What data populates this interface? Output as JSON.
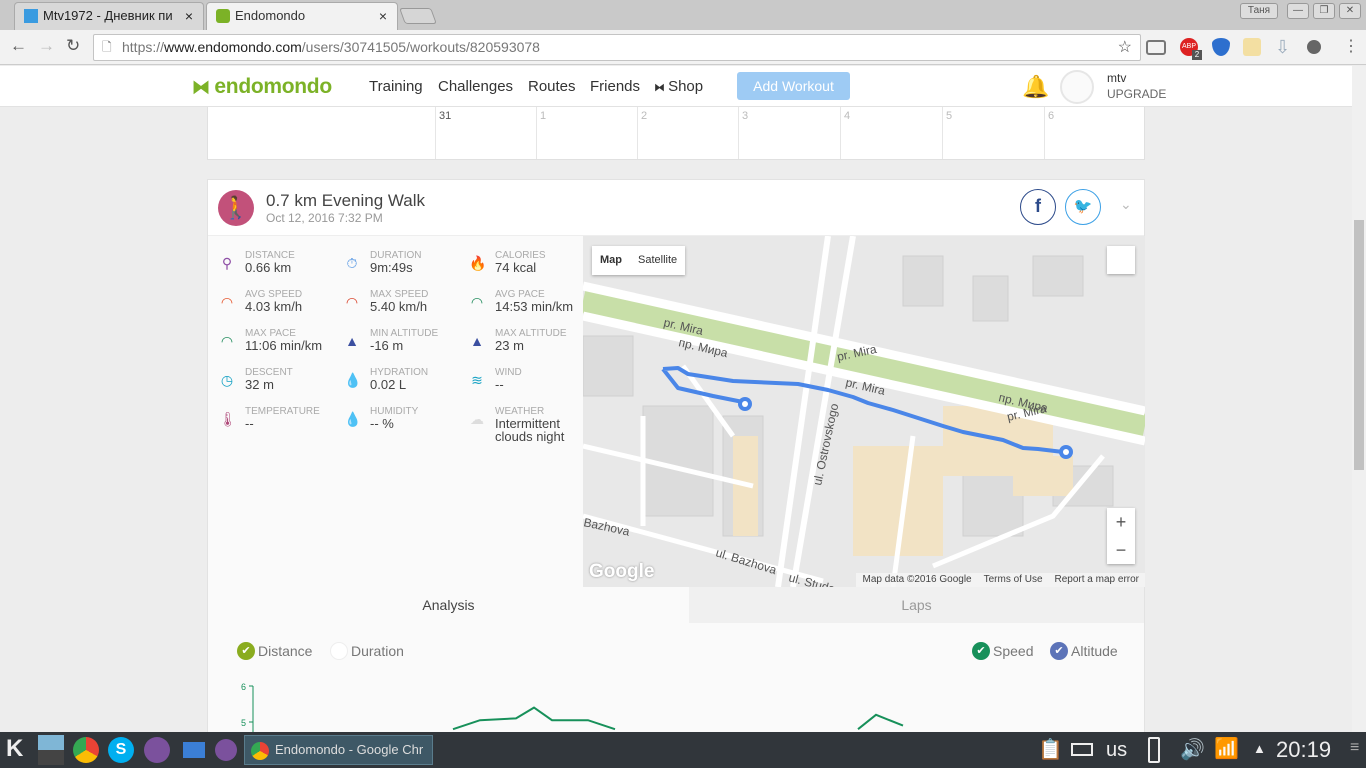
{
  "browser": {
    "tabs": [
      {
        "label": "Mtv1972 - Дневник пи",
        "active": false
      },
      {
        "label": "Endomondo",
        "active": true
      }
    ],
    "close_glyph": "×",
    "profile": "Таня",
    "url": {
      "scheme": "https://",
      "host": "www.endomondo.com",
      "path": "/users/30741505/workouts/820593078"
    },
    "extensions": [
      {
        "icon": "cast-icon"
      },
      {
        "icon": "adblock-icon",
        "badge": "2"
      },
      {
        "icon": "download-helper-icon"
      },
      {
        "icon": "extension-icon"
      },
      {
        "icon": "download-icon"
      },
      {
        "icon": "extension2-icon"
      }
    ]
  },
  "site": {
    "logo": "endomondo",
    "nav": [
      "Training",
      "Challenges",
      "Routes",
      "Friends",
      "Shop"
    ],
    "add_workout": "Add Workout",
    "user": "mtv",
    "upgrade": "UPGRADE"
  },
  "calendar": [
    "31",
    "1",
    "2",
    "3",
    "4",
    "5",
    "6"
  ],
  "workout": {
    "title": "0.7 km Evening Walk",
    "date": "Oct 12, 2016 7:32 PM",
    "stats": [
      {
        "label": "Distance",
        "value": "0.66 km",
        "icon": "distance-icon",
        "color": "#8e4fa6"
      },
      {
        "label": "Duration",
        "value": "9m:49s",
        "icon": "stopwatch-icon",
        "color": "#4a90e2"
      },
      {
        "label": "Calories",
        "value": "74 kcal",
        "icon": "flame-icon",
        "color": "#f26b3a"
      },
      {
        "label": "Avg Speed",
        "value": "4.03 km/h",
        "icon": "speedometer-icon",
        "color": "#e5532a"
      },
      {
        "label": "Max Speed",
        "value": "5.40 km/h",
        "icon": "speedometer-icon",
        "color": "#d9432a"
      },
      {
        "label": "Avg Pace",
        "value": "14:53 min/km",
        "icon": "pace-icon",
        "color": "#1e8a5a"
      },
      {
        "label": "Max Pace",
        "value": "11:06 min/km",
        "icon": "pace-icon",
        "color": "#1e8a5a"
      },
      {
        "label": "Min Altitude",
        "value": "-16 m",
        "icon": "mountain-icon",
        "color": "#3b4fa0"
      },
      {
        "label": "Max Altitude",
        "value": "23 m",
        "icon": "mountain-icon",
        "color": "#3b4fa0"
      },
      {
        "label": "Descent",
        "value": "32 m",
        "icon": "descent-icon",
        "color": "#17a2c4"
      },
      {
        "label": "Hydration",
        "value": "0.02 L",
        "icon": "water-drops-icon",
        "color": "#8fb8f0"
      },
      {
        "label": "Wind",
        "value": "--",
        "icon": "wind-icon",
        "color": "#17a2c4"
      },
      {
        "label": "Temperature",
        "value": "--",
        "icon": "thermometer-icon",
        "color": "#b04a7a"
      },
      {
        "label": "Humidity",
        "value": "-- %",
        "icon": "humidity-icon",
        "color": "#8fb8f0"
      },
      {
        "label": "Weather",
        "value": "Intermittent clouds night",
        "icon": "weather-cloud-icon",
        "color": "#ddd"
      }
    ]
  },
  "map": {
    "type_buttons": [
      "Map",
      "Satellite"
    ],
    "labels": [
      "pr. Mira",
      "пр. Мира",
      "pr. Mira",
      "pr. Mira",
      "пр. Мира",
      "pr. Mira",
      "ul. Ostrovskogo",
      "Bazhova",
      "ul. Bazhova",
      "ul. Studencheskaya"
    ],
    "zoom_in": "+",
    "zoom_out": "−",
    "logo": "Google",
    "footer": [
      "Map data ©2016 Google",
      "Terms of Use",
      "Report a map error"
    ]
  },
  "analysis": {
    "tabs": [
      "Analysis",
      "Laps"
    ],
    "x_axis_options": [
      {
        "label": "Distance",
        "checked": true,
        "color": "#8aac1f"
      },
      {
        "label": "Duration",
        "checked": false,
        "color": "#fff"
      }
    ],
    "series_toggles": [
      {
        "label": "Speed",
        "checked": true,
        "color": "#17905a"
      },
      {
        "label": "Altitude",
        "checked": true,
        "color": "#5c73b8"
      }
    ]
  },
  "chart_data": {
    "type": "line",
    "series": [
      {
        "name": "Speed",
        "x_fraction": [
          0.25,
          0.28,
          0.32,
          0.34,
          0.36,
          0.4,
          0.43,
          0.7,
          0.72,
          0.75
        ],
        "values": [
          4.8,
          5.05,
          5.1,
          5.4,
          5.05,
          5.05,
          4.8,
          4.8,
          5.2,
          4.9
        ]
      }
    ],
    "y_ticks": [
      "6",
      "5"
    ],
    "ylim": [
      4.8,
      6
    ]
  },
  "taskbar": {
    "window_title": "Endomondo - Google Chr",
    "keyboard": "us",
    "clock": "20:19"
  }
}
